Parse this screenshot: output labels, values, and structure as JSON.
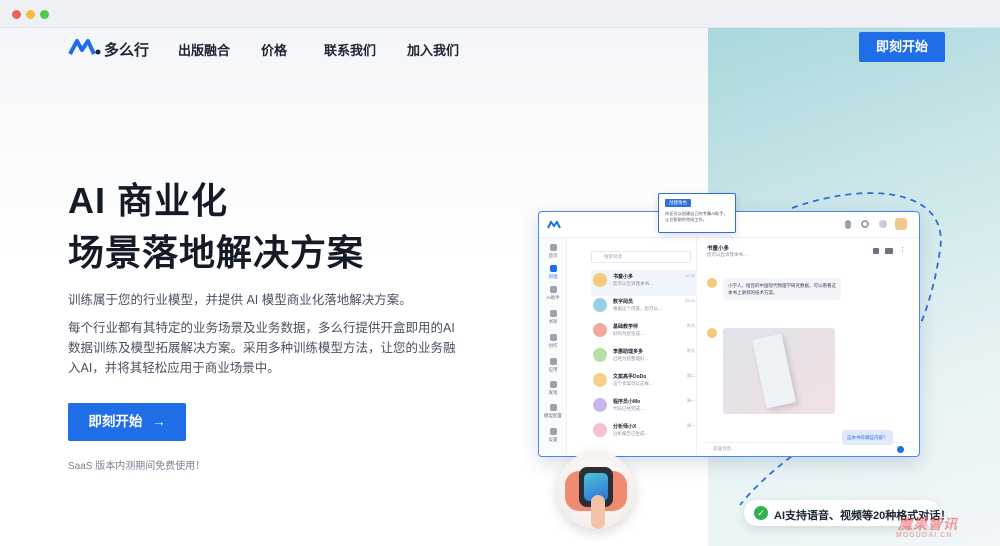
{
  "brand": {
    "name": "多么行"
  },
  "nav": {
    "items": [
      "出版融合",
      "价格",
      "联系我们",
      "加入我们"
    ],
    "cta": "即刻开始"
  },
  "hero": {
    "title_line1": "AI 商业化",
    "title_line2": "场景落地解决方案",
    "desc1": "训练属于您的行业模型，并提供 AI 模型商业化落地解决方案。",
    "desc2_line1": "每个行业都有其特定的业务场景及业务数据，多么行提供开盒即用的AI",
    "desc2_line2": "数据训练及模型拓展解决方案。采用多种训练模型方法，让您的业务融",
    "desc2_line3": "入AI，并将其轻松应用于商业场景中。",
    "cta": "即刻开始",
    "note": "SaaS 版本内测期间免费使用！"
  },
  "app": {
    "search_placeholder": "搜索对话",
    "rail": [
      "首页",
      "对话",
      "AI助手",
      "书架",
      "创作",
      "应用",
      "发现",
      "模型配置",
      "设置"
    ],
    "contacts": [
      {
        "name": "书童小多",
        "msg": "您可以告诉我本书...",
        "time": "10:20",
        "color": "#f5c97a"
      },
      {
        "name": "数字阅员",
        "msg": "根据这个内容，您可以...",
        "time": "09:41",
        "color": "#9ad0e6"
      },
      {
        "name": "基础教学伴",
        "msg": "好的为您生成...",
        "time": "昨天",
        "color": "#f4a9a0"
      },
      {
        "name": "李惠助理多多",
        "msg": "已经为您整理好...",
        "time": "昨天",
        "color": "#b7e0a8"
      },
      {
        "name": "文案高手DoDo",
        "msg": "这个文案可以这样...",
        "time": "周二",
        "color": "#f7d08a"
      },
      {
        "name": "程序员小Mo",
        "msg": "代码已经完成...",
        "time": "周一",
        "color": "#c9b8f0"
      },
      {
        "name": "分析师小X",
        "msg": "分析报告已生成...",
        "time": "周一",
        "color": "#f3c1d3"
      }
    ],
    "chat_title": "书童小多",
    "chat_sub": "您可以告诉我本书...",
    "msg1": "小学人，给您的中国现代物理学研究数据，可以看看这本书上讲到的技术方案。",
    "input_placeholder": "发送消息...",
    "reply_chip": "这本书有哪些内容？"
  },
  "tooltip": {
    "tag": "创建角色",
    "text": "你还可以创建自己的专属AI助手，让它帮助你完成工作。"
  },
  "badge": {
    "text": "AI支持语音、视频等20种格式对话！"
  },
  "watermark": {
    "line1": "魔果智讯",
    "line2": "MOGUOAI.CN"
  }
}
